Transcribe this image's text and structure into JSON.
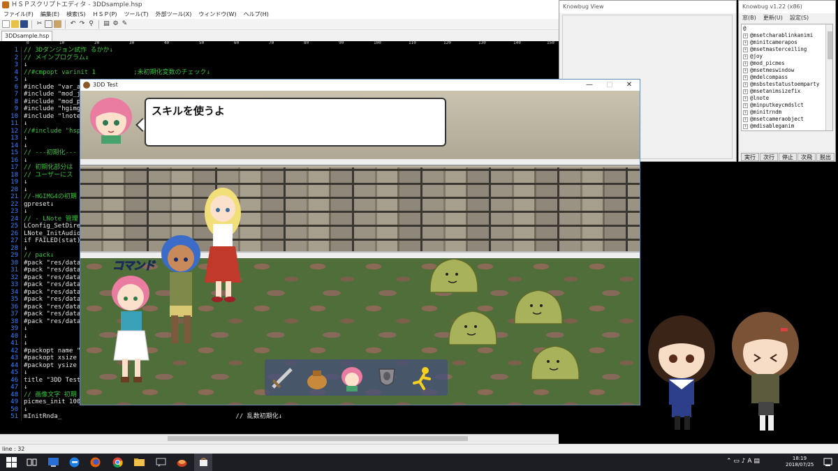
{
  "editor": {
    "title": "ＨＳＰスクリプトエディタ - 3DDsample.hsp",
    "menu": [
      "ファイル(F)",
      "編集(E)",
      "検索(S)",
      "ＨＳＰ(P)",
      "ツール(T)",
      "外部ツール(X)",
      "ウィンドウ(W)",
      "ヘルプ(H)"
    ],
    "tab": "3DDsample.hsp",
    "ruler": [
      "0",
      "10",
      "20",
      "30",
      "40",
      "50",
      "60",
      "70",
      "80",
      "90",
      "100",
      "110",
      "120",
      "130",
      "140",
      "150"
    ],
    "code_lines": [
      {
        "n": "1",
        "t": "// 3Dダンジョン試作 るかか↓",
        "c": true
      },
      {
        "n": "2",
        "t": "// メインプログラム↓",
        "c": true
      },
      {
        "n": "3",
        "t": "↓",
        "c": false
      },
      {
        "n": "4",
        "t": "//#cmpopt varinit 1          ;未初期化変数のチェック↓",
        "c": true
      },
      {
        "n": "5",
        "t": "↓",
        "c": false
      },
      {
        "n": "6",
        "t": "#include \"var_a",
        "c": false
      },
      {
        "n": "7",
        "t": "#include \"mod_jo",
        "c": false
      },
      {
        "n": "8",
        "t": "#include \"mod_pi",
        "c": false
      },
      {
        "n": "9",
        "t": "#include \"hgimg4",
        "c": false
      },
      {
        "n": "10",
        "t": "#include \"lnote.",
        "c": false
      },
      {
        "n": "11",
        "t": "↓",
        "c": false
      },
      {
        "n": "12",
        "t": "//#include \"hsp",
        "c": true
      },
      {
        "n": "13",
        "t": "↓",
        "c": false
      },
      {
        "n": "14",
        "t": "↓",
        "c": false
      },
      {
        "n": "15",
        "t": "// ---初期化---",
        "c": true
      },
      {
        "n": "16",
        "t": "↓",
        "c": false
      },
      {
        "n": "17",
        "t": "// 初期化部分は",
        "c": true
      },
      {
        "n": "18",
        "t": "// ユーザーにス",
        "c": true
      },
      {
        "n": "19",
        "t": "↓",
        "c": false
      },
      {
        "n": "20",
        "t": "↓",
        "c": false
      },
      {
        "n": "21",
        "t": "//-HGIMG4の初期",
        "c": true
      },
      {
        "n": "22",
        "t": "gpreset↓",
        "c": false
      },
      {
        "n": "23",
        "t": "↓",
        "c": false
      },
      {
        "n": "24",
        "t": "// - LNote 管理",
        "c": true
      },
      {
        "n": "25",
        "t": "LConfig_SetDirec",
        "c": false
      },
      {
        "n": "26",
        "t": "LNote_InitAudio",
        "c": false
      },
      {
        "n": "27",
        "t": "if FAILED(stat)",
        "c": false
      },
      {
        "n": "28",
        "t": "↓",
        "c": false
      },
      {
        "n": "29",
        "t": "// pack↓",
        "c": true
      },
      {
        "n": "30",
        "t": "#pack \"res/data/",
        "c": false
      },
      {
        "n": "31",
        "t": "#pack \"res/data/",
        "c": false
      },
      {
        "n": "32",
        "t": "#pack \"res/data/",
        "c": false
      },
      {
        "n": "33",
        "t": "#pack \"res/data/",
        "c": false
      },
      {
        "n": "34",
        "t": "#pack \"res/data/",
        "c": false
      },
      {
        "n": "35",
        "t": "#pack \"res/data/",
        "c": false
      },
      {
        "n": "36",
        "t": "#pack \"res/data/",
        "c": false
      },
      {
        "n": "37",
        "t": "#pack \"res/data/",
        "c": false
      },
      {
        "n": "38",
        "t": "#pack \"res/data/",
        "c": false
      },
      {
        "n": "39",
        "t": "↓",
        "c": false
      },
      {
        "n": "40",
        "t": "↓",
        "c": false
      },
      {
        "n": "41",
        "t": "↓",
        "c": false
      },
      {
        "n": "42",
        "t": "#packopt name \"3",
        "c": false
      },
      {
        "n": "43",
        "t": "#packopt xsize 1",
        "c": false
      },
      {
        "n": "44",
        "t": "#packopt ysize 7",
        "c": false
      },
      {
        "n": "45",
        "t": "↓",
        "c": false
      },
      {
        "n": "46",
        "t": "title \"3DD Test\"",
        "c": false
      },
      {
        "n": "47",
        "t": "↓",
        "c": false
      },
      {
        "n": "48",
        "t": "// 画像文字 初期",
        "c": true
      },
      {
        "n": "49",
        "t": "picmes_init 100↓",
        "c": false
      },
      {
        "n": "50",
        "t": "↓",
        "c": false
      },
      {
        "n": "51",
        "t": "mInitRnda_                                              // 乱数初期化↓",
        "c": false
      }
    ],
    "status": "line : 32"
  },
  "knowbug_view": {
    "title": "Knowbug View"
  },
  "knowbug": {
    "title": "Knowbug v1.22 (x86)",
    "menu": [
      "窓(B)",
      "更新(U)",
      "設定(S)"
    ],
    "root": "@",
    "tree": [
      "@msetcharablinkanimi",
      "@minitcamerapos",
      "@msetmasterceiling",
      "@joy",
      "@mod_picmes",
      "@msetmeswindow",
      "@mdelcompass",
      "@msbstestatustoemparty",
      "@msetanimsizefix",
      "@lnote",
      "@minputkeycmdslct",
      "@minitrndm",
      "@msetcameraobject",
      "@mdisableganim"
    ],
    "buttons": [
      "実行",
      "次行",
      "停止",
      "次飛",
      "脱出"
    ]
  },
  "game": {
    "title": "3DD Test",
    "controls": [
      "—",
      "□",
      "✕"
    ],
    "speech": "スキルを使うよ",
    "command_label": "コマンド",
    "commands": [
      "sword-icon",
      "bag-icon",
      "character-icon",
      "shield-icon",
      "run-icon"
    ]
  },
  "taskbar": {
    "time": "18:19",
    "date": "2018/07/25"
  },
  "colors": {
    "code_bg": "#000000",
    "line_number": "#3b83ff",
    "comment": "#39c43d",
    "floor": "#4f6e3a",
    "slime": "#a7b25a"
  }
}
